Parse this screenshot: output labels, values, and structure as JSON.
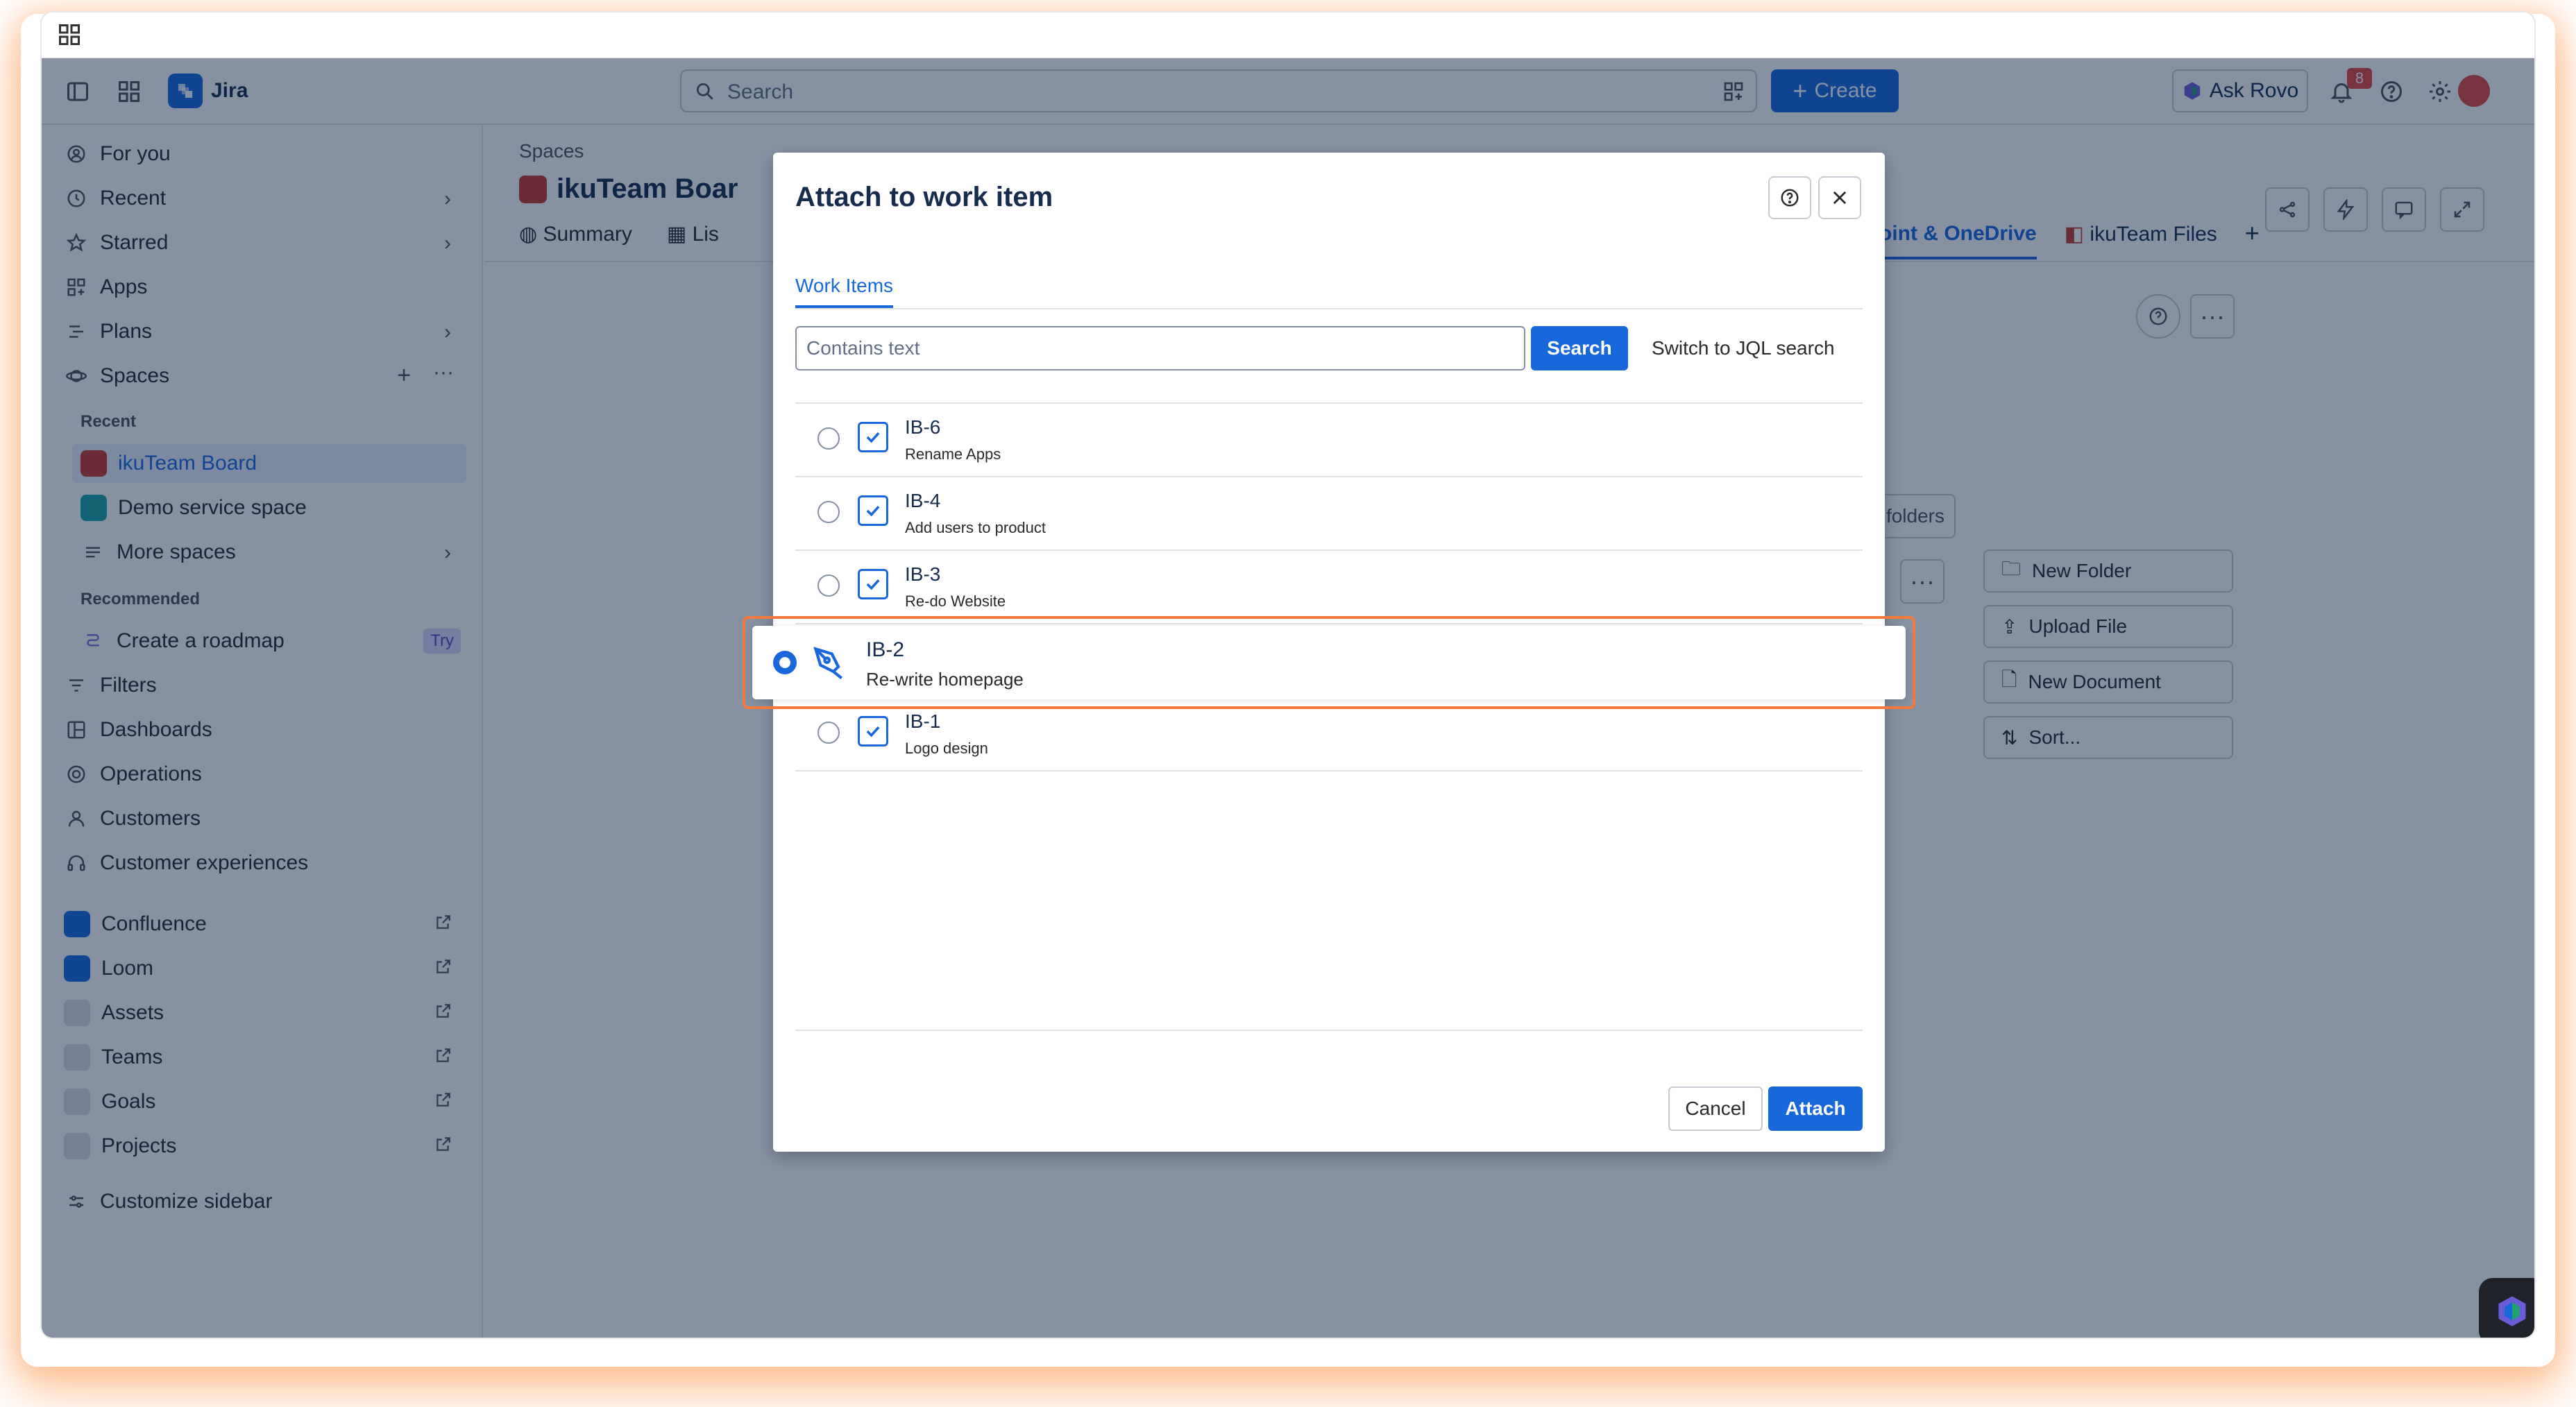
{
  "topnav": {
    "app_name": "Jira",
    "search_placeholder": "Search",
    "create_label": "Create",
    "rovo_label": "Ask Rovo",
    "notification_count": "8"
  },
  "sidebar": {
    "items": [
      {
        "label": "For you",
        "icon": "person-circle-icon"
      },
      {
        "label": "Recent",
        "icon": "clock-icon"
      },
      {
        "label": "Starred",
        "icon": "star-icon"
      },
      {
        "label": "Apps",
        "icon": "apps-icon"
      },
      {
        "label": "Plans",
        "icon": "plans-icon"
      },
      {
        "label": "Spaces",
        "icon": "spaces-icon"
      }
    ],
    "recent_label": "Recent",
    "recent_spaces": [
      "ikuTeam Board",
      "Demo service space",
      "More spaces"
    ],
    "recommended_label": "Recommended",
    "roadmap_label": "Create a roadmap",
    "try_label": "Try",
    "lower_items": [
      "Filters",
      "Dashboards",
      "Operations",
      "Customers",
      "Customer experiences"
    ],
    "apps": [
      "Confluence",
      "Loom",
      "Assets",
      "Teams",
      "Goals",
      "Projects"
    ],
    "customize_label": "Customize sidebar"
  },
  "main": {
    "breadcrumb": "Spaces",
    "title": "ikuTeam Boar",
    "tabs": [
      "Summary",
      "Lis"
    ],
    "tabs_right": [
      "Point & OneDrive",
      "ikuTeam Files"
    ],
    "folders_label": "folders",
    "actions": [
      "New Folder",
      "Upload File",
      "New Document",
      "Sort..."
    ]
  },
  "modal": {
    "title": "Attach to work item",
    "tab": "Work Items",
    "input_placeholder": "Contains text",
    "search_label": "Search",
    "jql_label": "Switch to JQL search",
    "items": [
      {
        "key": "IB-6",
        "summary": "Rename Apps"
      },
      {
        "key": "IB-4",
        "summary": "Add users to product"
      },
      {
        "key": "IB-3",
        "summary": "Re-do Website"
      },
      {
        "key": "IB-2",
        "summary": "Re-write homepage"
      },
      {
        "key": "IB-1",
        "summary": "Logo design"
      }
    ],
    "selected_key": "IB-2",
    "cancel_label": "Cancel",
    "attach_label": "Attach"
  }
}
